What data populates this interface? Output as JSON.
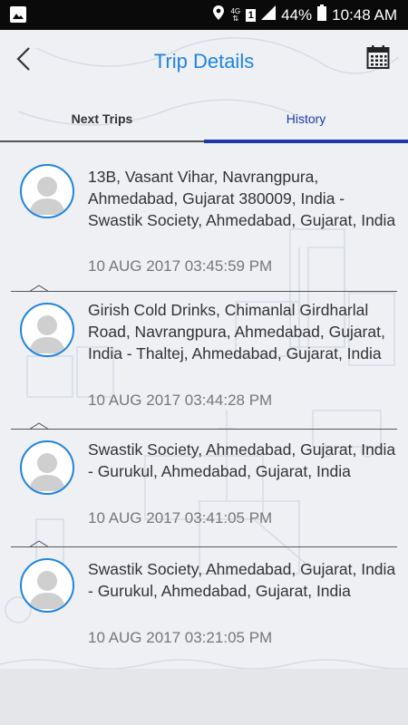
{
  "status_bar": {
    "network": "4G",
    "sim": "1",
    "battery": "44%",
    "time": "10:48 AM"
  },
  "header": {
    "title": "Trip Details"
  },
  "tabs": [
    {
      "label": "Next Trips",
      "active": false
    },
    {
      "label": "History",
      "active": true
    }
  ],
  "trips": [
    {
      "route": "13B, Vasant Vihar, Navrangpura, Ahmedabad, Gujarat 380009, India - Swastik Society, Ahmedabad, Gujarat, India",
      "datetime": "10 AUG 2017 03:45:59 PM"
    },
    {
      "route": "Girish Cold Drinks, Chimanlal Girdharlal Road, Navrangpura, Ahmedabad, Gujarat, India - Thaltej, Ahmedabad, Gujarat, India",
      "datetime": "10 AUG 2017 03:44:28 PM"
    },
    {
      "route": "Swastik Society, Ahmedabad, Gujarat, India - Gurukul, Ahmedabad, Gujarat, India",
      "datetime": "10 AUG 2017 03:41:05 PM"
    },
    {
      "route": "Swastik Society, Ahmedabad, Gujarat, India - Gurukul, Ahmedabad, Gujarat, India",
      "datetime": "10 AUG 2017 03:21:05 PM"
    }
  ],
  "colors": {
    "accent": "#1f84e0",
    "tab_active": "#1e3aa6",
    "background": "#eef0f4"
  }
}
